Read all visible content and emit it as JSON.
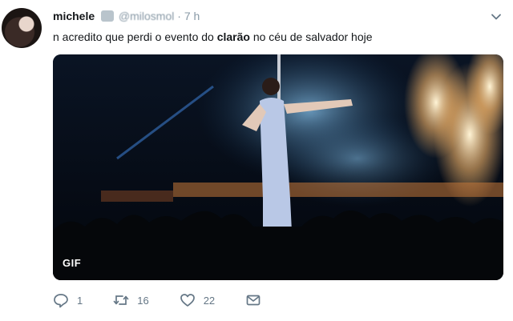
{
  "tweet": {
    "author_name": "michele",
    "handle": "@milosmol",
    "separator": "·",
    "time": "7 h",
    "text_before": "n acredito que perdi o evento do ",
    "text_bold": "clarão",
    "text_after": " no céu de salvador hoje",
    "media": {
      "badge": "GIF"
    }
  },
  "actions": {
    "replies": "1",
    "retweets": "16",
    "likes": "22"
  },
  "icons": {
    "more": "chevron-down-icon",
    "reply": "reply-icon",
    "retweet": "retweet-icon",
    "like": "heart-icon",
    "dm": "envelope-icon"
  },
  "colors": {
    "icon": "#657786",
    "secondary_text": "#8899a6"
  }
}
